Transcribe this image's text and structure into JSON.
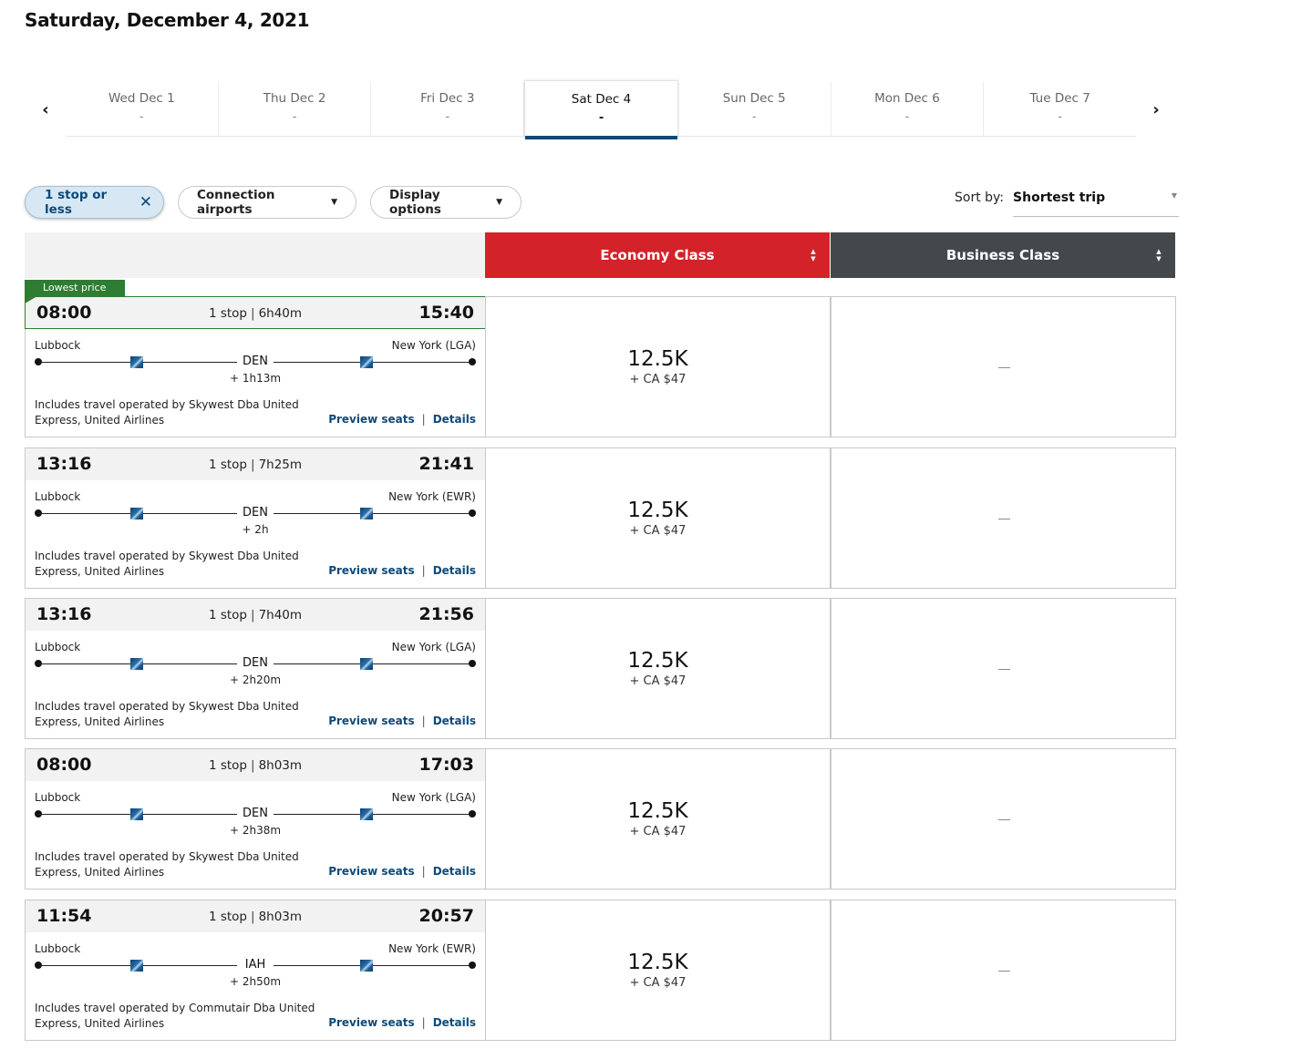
{
  "page_title": "Saturday, December 4, 2021",
  "date_nav": {
    "prev_icon": "chevron-left-icon",
    "next_icon": "chevron-right-icon",
    "prev_glyph": "‹",
    "next_glyph": "›",
    "dates": [
      {
        "label": "Wed Dec 1",
        "price": "-",
        "active": false
      },
      {
        "label": "Thu Dec 2",
        "price": "-",
        "active": false
      },
      {
        "label": "Fri Dec 3",
        "price": "-",
        "active": false
      },
      {
        "label": "Sat Dec 4",
        "price": "-",
        "active": true
      },
      {
        "label": "Sun Dec 5",
        "price": "-",
        "active": false
      },
      {
        "label": "Mon Dec 6",
        "price": "-",
        "active": false
      },
      {
        "label": "Tue Dec 7",
        "price": "-",
        "active": false
      }
    ]
  },
  "filters": {
    "stops_chip": {
      "label": "1 stop or less",
      "remove_glyph": "✕"
    },
    "connection_airports": {
      "label": "Connection airports",
      "caret": "▼"
    },
    "display_options": {
      "label": "Display options",
      "caret": "▼"
    }
  },
  "sort": {
    "label": "Sort by:",
    "value": "Shortest trip",
    "caret": "▼"
  },
  "columns": {
    "economy": {
      "label": "Economy Class",
      "color": "#d3222a"
    },
    "business": {
      "label": "Business Class",
      "color": "#43484c"
    },
    "sort_up": "▲",
    "sort_down": "▼"
  },
  "lowest_badge": "Lowest price",
  "accent_colors": {
    "lowest_price_green": "#2e7d32",
    "link_blue": "#0c4a7a",
    "active_tab_underline": "#0b4a78"
  },
  "flights": [
    {
      "depart": "08:00",
      "arrive": "15:40",
      "stops": "1 stop",
      "duration": "6h40m",
      "origin": "Lubbock",
      "destination": "New York (LGA)",
      "connection": "DEN",
      "layover": "+ 1h13m",
      "operated_by": "Includes travel operated by Skywest Dba United Express, United Airlines",
      "preview_seats": "Preview seats",
      "details": "Details",
      "link_sep": "|",
      "economy": {
        "miles": "12.5K",
        "tax": "+ CA $47"
      },
      "business": {
        "available": false
      },
      "lowest_price": true
    },
    {
      "depart": "13:16",
      "arrive": "21:41",
      "stops": "1 stop",
      "duration": "7h25m",
      "origin": "Lubbock",
      "destination": "New York (EWR)",
      "connection": "DEN",
      "layover": "+ 2h",
      "operated_by": "Includes travel operated by Skywest Dba United Express, United Airlines",
      "preview_seats": "Preview seats",
      "details": "Details",
      "link_sep": "|",
      "economy": {
        "miles": "12.5K",
        "tax": "+ CA $47"
      },
      "business": {
        "available": false
      },
      "lowest_price": false
    },
    {
      "depart": "13:16",
      "arrive": "21:56",
      "stops": "1 stop",
      "duration": "7h40m",
      "origin": "Lubbock",
      "destination": "New York (LGA)",
      "connection": "DEN",
      "layover": "+ 2h20m",
      "operated_by": "Includes travel operated by Skywest Dba United Express, United Airlines",
      "preview_seats": "Preview seats",
      "details": "Details",
      "link_sep": "|",
      "economy": {
        "miles": "12.5K",
        "tax": "+ CA $47"
      },
      "business": {
        "available": false
      },
      "lowest_price": false
    },
    {
      "depart": "08:00",
      "arrive": "17:03",
      "stops": "1 stop",
      "duration": "8h03m",
      "origin": "Lubbock",
      "destination": "New York (LGA)",
      "connection": "DEN",
      "layover": "+ 2h38m",
      "operated_by": "Includes travel operated by Skywest Dba United Express, United Airlines",
      "preview_seats": "Preview seats",
      "details": "Details",
      "link_sep": "|",
      "economy": {
        "miles": "12.5K",
        "tax": "+ CA $47"
      },
      "business": {
        "available": false
      },
      "lowest_price": false
    },
    {
      "depart": "11:54",
      "arrive": "20:57",
      "stops": "1 stop",
      "duration": "8h03m",
      "origin": "Lubbock",
      "destination": "New York (EWR)",
      "connection": "IAH",
      "layover": "+ 2h50m",
      "operated_by": "Includes travel operated by Commutair Dba United Express, United Airlines",
      "preview_seats": "Preview seats",
      "details": "Details",
      "link_sep": "|",
      "economy": {
        "miles": "12.5K",
        "tax": "+ CA $47"
      },
      "business": {
        "available": false
      },
      "lowest_price": false
    }
  ]
}
